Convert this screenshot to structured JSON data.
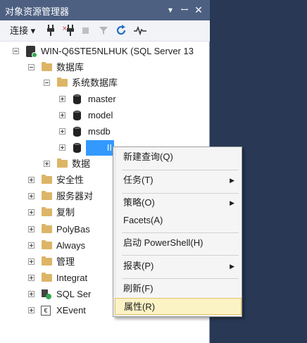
{
  "panel": {
    "title": "对象资源管理器"
  },
  "toolbar": {
    "connect_label": "连接 ▾"
  },
  "tree": {
    "server": "WIN-Q6STE5NLHUK (SQL Server 13",
    "databases": "数据库",
    "system_databases": "系统数据库",
    "master": "master",
    "model": "model",
    "msdb": "msdb",
    "selected": "II",
    "snapshots": "数据",
    "security": "安全性",
    "server_objects": "服务器对",
    "replication": "复制",
    "polybase": "PolyBas",
    "always": "Always",
    "management": "管理",
    "integration": "Integrat",
    "agent": "SQL Ser",
    "xevent": "XEvent"
  },
  "menu": {
    "new_query": "新建查询(Q)",
    "tasks": "任务(T)",
    "policies": "策略(O)",
    "facets": "Facets(A)",
    "powershell": "启动 PowerShell(H)",
    "reports": "报表(P)",
    "refresh": "刷新(F)",
    "properties": "属性(R)"
  }
}
